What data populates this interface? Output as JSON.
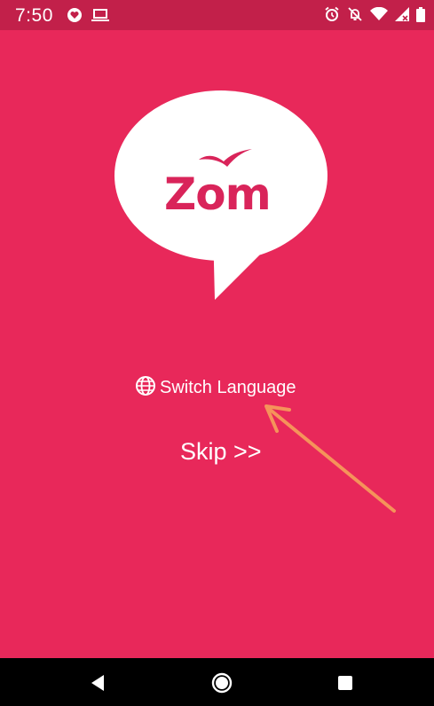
{
  "status_bar": {
    "time": "7:50",
    "left_icons": [
      "heart-shield-icon",
      "laptop-icon"
    ],
    "right_icons": [
      "alarm-icon",
      "bell-off-icon",
      "wifi-icon",
      "signal-icon",
      "battery-icon"
    ]
  },
  "logo": {
    "text": "Zom",
    "icon": "bird-icon"
  },
  "language": {
    "icon": "globe-icon",
    "label": "Switch Language"
  },
  "skip": {
    "label": "Skip >>"
  },
  "nav": {
    "icons": [
      "back-icon",
      "home-icon",
      "recents-icon"
    ]
  },
  "colors": {
    "background": "#E8285A",
    "status_bar": "#C2204A",
    "logo_text": "#D9245A",
    "annotation": "#F5935A",
    "nav_bar": "#000000"
  }
}
